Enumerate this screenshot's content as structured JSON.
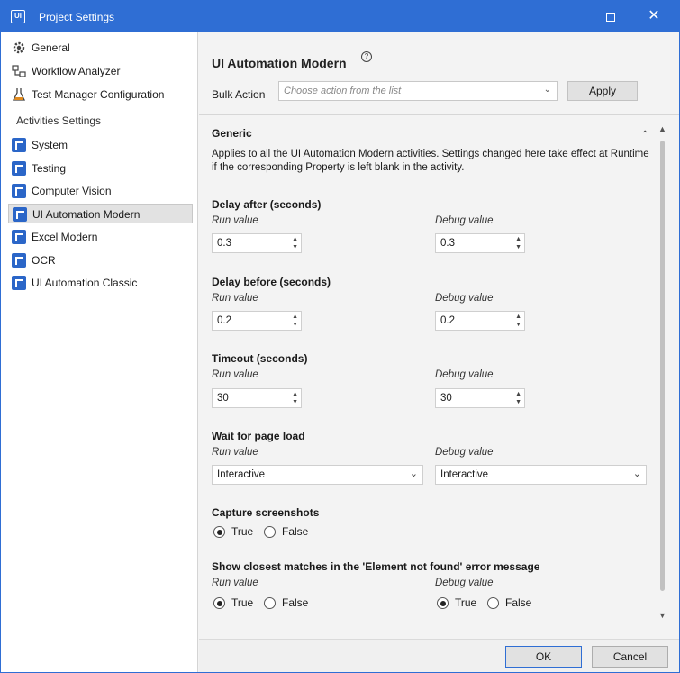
{
  "window": {
    "title": "Project Settings",
    "app_icon_text": "Ui",
    "maximize_icon": "maximize-icon",
    "close_glyph": "✕",
    "accent_color": "#2f6ed4"
  },
  "sidebar": {
    "top_items": [
      {
        "label": "General",
        "icon": "gear-icon"
      },
      {
        "label": "Workflow Analyzer",
        "icon": "analyzer-icon"
      },
      {
        "label": "Test Manager Configuration",
        "icon": "test-manager-icon"
      }
    ],
    "section_label": "Activities Settings",
    "activity_items": [
      {
        "label": "System",
        "icon": "activity-pack-icon"
      },
      {
        "label": "Testing",
        "icon": "activity-pack-icon"
      },
      {
        "label": "Computer Vision",
        "icon": "activity-pack-icon"
      },
      {
        "label": "UI Automation Modern",
        "icon": "activity-pack-icon",
        "selected": true
      },
      {
        "label": "Excel Modern",
        "icon": "activity-pack-icon"
      },
      {
        "label": "OCR",
        "icon": "activity-pack-icon"
      },
      {
        "label": "UI Automation Classic",
        "icon": "activity-pack-icon"
      }
    ]
  },
  "main": {
    "title": "UI Automation Modern",
    "help_glyph": "?",
    "bulk_action": {
      "label": "Bulk Action",
      "placeholder": "Choose action from the list",
      "apply_label": "Apply"
    },
    "section": {
      "title": "Generic",
      "description": "Applies to all the UI Automation Modern activities. Settings changed here take effect at Runtime if the corresponding Property is left blank in the activity."
    },
    "run_value_label": "Run value",
    "debug_value_label": "Debug value",
    "delay_after": {
      "label": "Delay after (seconds)",
      "run": "0.3",
      "debug": "0.3"
    },
    "delay_before": {
      "label": "Delay before (seconds)",
      "run": "0.2",
      "debug": "0.2"
    },
    "timeout": {
      "label": "Timeout (seconds)",
      "run": "30",
      "debug": "30"
    },
    "wait_for_page_load": {
      "label": "Wait for page load",
      "run": "Interactive",
      "debug": "Interactive"
    },
    "capture_screenshots": {
      "label": "Capture screenshots",
      "true_label": "True",
      "false_label": "False",
      "selected": "True"
    },
    "closest_matches": {
      "label": "Show closest matches in the 'Element not found' error message",
      "true_label": "True",
      "false_label": "False",
      "run_selected": "True",
      "debug_selected": "True"
    }
  },
  "footer": {
    "ok_label": "OK",
    "cancel_label": "Cancel"
  }
}
